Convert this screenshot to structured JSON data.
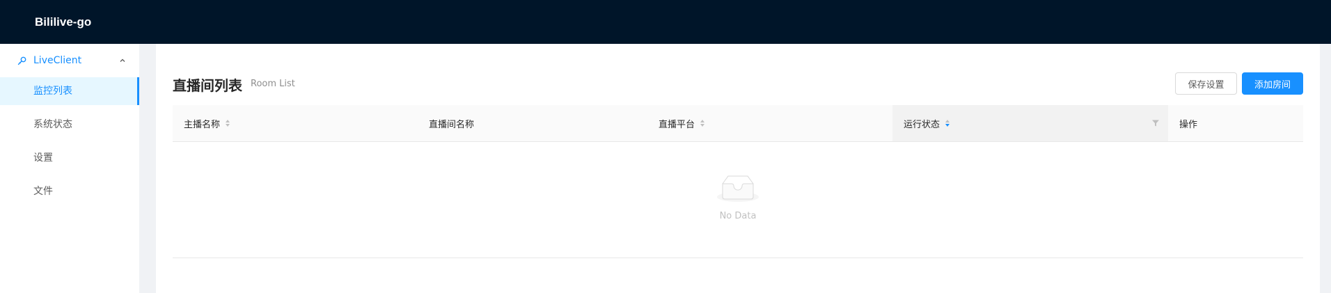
{
  "app": {
    "title": "Bililive-go"
  },
  "sidebar": {
    "group": {
      "label": "LiveClient",
      "icon": "api-icon",
      "expanded": true
    },
    "items": [
      {
        "label": "监控列表",
        "selected": true
      },
      {
        "label": "系统状态",
        "selected": false
      },
      {
        "label": "设置",
        "selected": false
      },
      {
        "label": "文件",
        "selected": false
      }
    ]
  },
  "page": {
    "title": "直播间列表",
    "subtitle": "Room List",
    "save_button": "保存设置",
    "add_button": "添加房间"
  },
  "table": {
    "columns": [
      {
        "label": "主播名称",
        "sortable": true
      },
      {
        "label": "直播间名称",
        "sortable": false
      },
      {
        "label": "直播平台",
        "sortable": true
      },
      {
        "label": "运行状态",
        "sortable": true,
        "sorted": "descend",
        "filterable": true
      },
      {
        "label": "操作",
        "sortable": false
      }
    ],
    "rows": [],
    "empty_text": "No Data"
  },
  "colors": {
    "header_bg": "#001529",
    "primary": "#1890ff",
    "selected_bg": "#e6f7ff"
  }
}
